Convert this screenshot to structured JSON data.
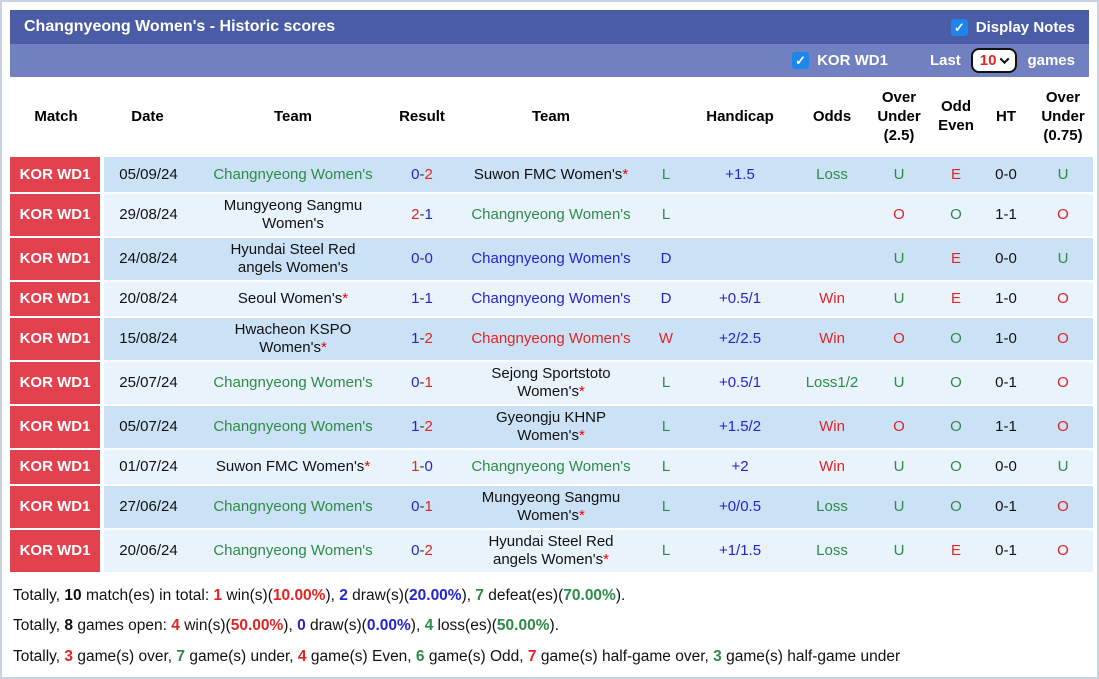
{
  "titlebar": {
    "title": "Changnyeong Women's - Historic scores",
    "display_notes_label": "Display Notes",
    "display_notes_checked": true
  },
  "filterbar": {
    "league_label": "KOR WD1",
    "league_checked": true,
    "last_label": "Last",
    "games_count": "10",
    "games_label": "games"
  },
  "colors": {
    "header_blue": "#4a5ca6",
    "subheader_blue": "#7080c1",
    "match_column_red": "#e2414e",
    "row_stripe_dark": "#cbe2f6",
    "row_stripe_light": "#e9f3fb",
    "win_red": "#e02424",
    "draw_blue": "#2424cc",
    "loss_green": "#2e8b47",
    "checkbox_blue": "#1d86ea"
  },
  "table": {
    "columns": [
      "Match",
      "Date",
      "Team",
      "Result",
      "Team",
      "",
      "Handicap",
      "Odds",
      "Over Under (2.5)",
      "Odd Even",
      "HT",
      "Over Under (0.75)"
    ],
    "rows": [
      {
        "match": "KOR WD1",
        "date": "05/09/24",
        "home": {
          "name": "Changnyeong Women's",
          "color": "green",
          "star": false
        },
        "score": {
          "home": "0",
          "home_color": "blue",
          "away": "2",
          "away_color": "red"
        },
        "away": {
          "name": "Suwon FMC Women's",
          "color": "black",
          "star": true
        },
        "letter": {
          "text": "L",
          "color": "green"
        },
        "handicap": "+1.5",
        "odds": {
          "text": "Loss",
          "color": "green"
        },
        "ou25": {
          "text": "U",
          "color": "green"
        },
        "oddeven": {
          "text": "E",
          "color": "red"
        },
        "ht": "0-0",
        "ou075": {
          "text": "U",
          "color": "green"
        }
      },
      {
        "match": "KOR WD1",
        "date": "29/08/24",
        "home": {
          "name": "Mungyeong Sangmu Women's",
          "color": "black",
          "star": false
        },
        "score": {
          "home": "2",
          "home_color": "red",
          "away": "1",
          "away_color": "blue"
        },
        "away": {
          "name": "Changnyeong Women's",
          "color": "green",
          "star": false
        },
        "letter": {
          "text": "L",
          "color": "green"
        },
        "handicap": "",
        "odds": {
          "text": "",
          "color": "black"
        },
        "ou25": {
          "text": "O",
          "color": "red"
        },
        "oddeven": {
          "text": "O",
          "color": "green"
        },
        "ht": "1-1",
        "ou075": {
          "text": "O",
          "color": "red"
        }
      },
      {
        "match": "KOR WD1",
        "date": "24/08/24",
        "home": {
          "name": "Hyundai Steel Red angels Women's",
          "color": "black",
          "star": false
        },
        "score": {
          "home": "0",
          "home_color": "blue",
          "away": "0",
          "away_color": "blue"
        },
        "away": {
          "name": "Changnyeong Women's",
          "color": "blue",
          "star": false
        },
        "letter": {
          "text": "D",
          "color": "blue"
        },
        "handicap": "",
        "odds": {
          "text": "",
          "color": "black"
        },
        "ou25": {
          "text": "U",
          "color": "green"
        },
        "oddeven": {
          "text": "E",
          "color": "red"
        },
        "ht": "0-0",
        "ou075": {
          "text": "U",
          "color": "green"
        }
      },
      {
        "match": "KOR WD1",
        "date": "20/08/24",
        "home": {
          "name": "Seoul Women's",
          "color": "black",
          "star": true
        },
        "score": {
          "home": "1",
          "home_color": "blue",
          "away": "1",
          "away_color": "blue"
        },
        "away": {
          "name": "Changnyeong Women's",
          "color": "blue",
          "star": false
        },
        "letter": {
          "text": "D",
          "color": "blue"
        },
        "handicap": "+0.5/1",
        "odds": {
          "text": "Win",
          "color": "red"
        },
        "ou25": {
          "text": "U",
          "color": "green"
        },
        "oddeven": {
          "text": "E",
          "color": "red"
        },
        "ht": "1-0",
        "ou075": {
          "text": "O",
          "color": "red"
        }
      },
      {
        "match": "KOR WD1",
        "date": "15/08/24",
        "home": {
          "name": "Hwacheon KSPO Women's",
          "color": "black",
          "star": true
        },
        "score": {
          "home": "1",
          "home_color": "blue",
          "away": "2",
          "away_color": "red"
        },
        "away": {
          "name": "Changnyeong Women's",
          "color": "red",
          "star": false
        },
        "letter": {
          "text": "W",
          "color": "red"
        },
        "handicap": "+2/2.5",
        "odds": {
          "text": "Win",
          "color": "red"
        },
        "ou25": {
          "text": "O",
          "color": "red"
        },
        "oddeven": {
          "text": "O",
          "color": "green"
        },
        "ht": "1-0",
        "ou075": {
          "text": "O",
          "color": "red"
        }
      },
      {
        "match": "KOR WD1",
        "date": "25/07/24",
        "home": {
          "name": "Changnyeong Women's",
          "color": "green",
          "star": false
        },
        "score": {
          "home": "0",
          "home_color": "blue",
          "away": "1",
          "away_color": "red"
        },
        "away": {
          "name": "Sejong Sportstoto Women's",
          "color": "black",
          "star": true
        },
        "letter": {
          "text": "L",
          "color": "green"
        },
        "handicap": "+0.5/1",
        "odds": {
          "text": "Loss1/2",
          "color": "green"
        },
        "ou25": {
          "text": "U",
          "color": "green"
        },
        "oddeven": {
          "text": "O",
          "color": "green"
        },
        "ht": "0-1",
        "ou075": {
          "text": "O",
          "color": "red"
        }
      },
      {
        "match": "KOR WD1",
        "date": "05/07/24",
        "home": {
          "name": "Changnyeong Women's",
          "color": "green",
          "star": false
        },
        "score": {
          "home": "1",
          "home_color": "blue",
          "away": "2",
          "away_color": "red"
        },
        "away": {
          "name": "Gyeongju KHNP Women's",
          "color": "black",
          "star": true
        },
        "letter": {
          "text": "L",
          "color": "green"
        },
        "handicap": "+1.5/2",
        "odds": {
          "text": "Win",
          "color": "red"
        },
        "ou25": {
          "text": "O",
          "color": "red"
        },
        "oddeven": {
          "text": "O",
          "color": "green"
        },
        "ht": "1-1",
        "ou075": {
          "text": "O",
          "color": "red"
        }
      },
      {
        "match": "KOR WD1",
        "date": "01/07/24",
        "home": {
          "name": "Suwon FMC Women's",
          "color": "black",
          "star": true
        },
        "score": {
          "home": "1",
          "home_color": "red",
          "away": "0",
          "away_color": "blue"
        },
        "away": {
          "name": "Changnyeong Women's",
          "color": "green",
          "star": false
        },
        "letter": {
          "text": "L",
          "color": "green"
        },
        "handicap": "+2",
        "odds": {
          "text": "Win",
          "color": "red"
        },
        "ou25": {
          "text": "U",
          "color": "green"
        },
        "oddeven": {
          "text": "O",
          "color": "green"
        },
        "ht": "0-0",
        "ou075": {
          "text": "U",
          "color": "green"
        }
      },
      {
        "match": "KOR WD1",
        "date": "27/06/24",
        "home": {
          "name": "Changnyeong Women's",
          "color": "green",
          "star": false
        },
        "score": {
          "home": "0",
          "home_color": "blue",
          "away": "1",
          "away_color": "red"
        },
        "away": {
          "name": "Mungyeong Sangmu Women's",
          "color": "black",
          "star": true
        },
        "letter": {
          "text": "L",
          "color": "green"
        },
        "handicap": "+0/0.5",
        "odds": {
          "text": "Loss",
          "color": "green"
        },
        "ou25": {
          "text": "U",
          "color": "green"
        },
        "oddeven": {
          "text": "O",
          "color": "green"
        },
        "ht": "0-1",
        "ou075": {
          "text": "O",
          "color": "red"
        }
      },
      {
        "match": "KOR WD1",
        "date": "20/06/24",
        "home": {
          "name": "Changnyeong Women's",
          "color": "green",
          "star": false
        },
        "score": {
          "home": "0",
          "home_color": "blue",
          "away": "2",
          "away_color": "red"
        },
        "away": {
          "name": "Hyundai Steel Red angels Women's",
          "color": "black",
          "star": true
        },
        "letter": {
          "text": "L",
          "color": "green"
        },
        "handicap": "+1/1.5",
        "odds": {
          "text": "Loss",
          "color": "green"
        },
        "ou25": {
          "text": "U",
          "color": "green"
        },
        "oddeven": {
          "text": "E",
          "color": "red"
        },
        "ht": "0-1",
        "ou075": {
          "text": "O",
          "color": "red"
        }
      }
    ]
  },
  "summary": {
    "lines": [
      [
        {
          "text": "Totally, "
        },
        {
          "text": "10",
          "bold": true
        },
        {
          "text": " match(es) in total: "
        },
        {
          "text": "1",
          "color": "red",
          "bold": true
        },
        {
          "text": " win(s)("
        },
        {
          "text": "10.00%",
          "color": "red",
          "bold": true
        },
        {
          "text": "), "
        },
        {
          "text": "2",
          "color": "blue",
          "bold": true
        },
        {
          "text": " draw(s)("
        },
        {
          "text": "20.00%",
          "color": "blue",
          "bold": true
        },
        {
          "text": "), "
        },
        {
          "text": "7",
          "color": "green",
          "bold": true
        },
        {
          "text": " defeat(es)("
        },
        {
          "text": "70.00%",
          "color": "green",
          "bold": true
        },
        {
          "text": ")."
        }
      ],
      [
        {
          "text": "Totally, "
        },
        {
          "text": "8",
          "bold": true
        },
        {
          "text": " games open: "
        },
        {
          "text": "4",
          "color": "red",
          "bold": true
        },
        {
          "text": " win(s)("
        },
        {
          "text": "50.00%",
          "color": "red",
          "bold": true
        },
        {
          "text": "), "
        },
        {
          "text": "0",
          "color": "blue",
          "bold": true
        },
        {
          "text": " draw(s)("
        },
        {
          "text": "0.00%",
          "color": "blue",
          "bold": true
        },
        {
          "text": "), "
        },
        {
          "text": "4",
          "color": "green",
          "bold": true
        },
        {
          "text": " loss(es)("
        },
        {
          "text": "50.00%",
          "color": "green",
          "bold": true
        },
        {
          "text": ")."
        }
      ],
      [
        {
          "text": "Totally, "
        },
        {
          "text": "3",
          "color": "red",
          "bold": true
        },
        {
          "text": " game(s) over, "
        },
        {
          "text": "7",
          "color": "green",
          "bold": true
        },
        {
          "text": " game(s) under, "
        },
        {
          "text": "4",
          "color": "red",
          "bold": true
        },
        {
          "text": " game(s) Even, "
        },
        {
          "text": "6",
          "color": "green",
          "bold": true
        },
        {
          "text": " game(s) Odd, "
        },
        {
          "text": "7",
          "color": "red",
          "bold": true
        },
        {
          "text": " game(s) half-game over, "
        },
        {
          "text": "3",
          "color": "green",
          "bold": true
        },
        {
          "text": " game(s) half-game under"
        }
      ]
    ]
  }
}
